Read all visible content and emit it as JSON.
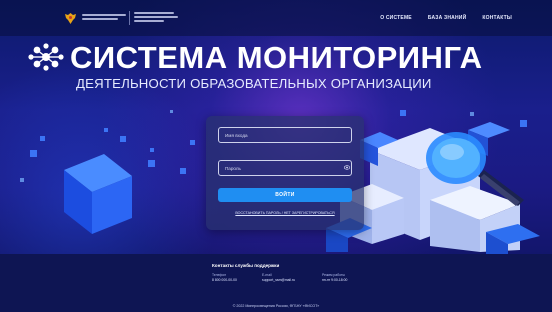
{
  "header": {
    "nav": [
      "О СИСТЕМЕ",
      "БАЗА ЗНАНИЙ",
      "КОНТАКТЫ"
    ]
  },
  "hero": {
    "title": "СИСТЕМА МОНИТОРИНГА",
    "subtitle": "ДЕЯТЕЛЬНОСТИ ОБРАЗОВАТЕЛЬНЫХ ОРГАНИЗАЦИИ"
  },
  "login": {
    "login_placeholder": "Имя входа",
    "password_placeholder": "Пароль",
    "submit_label": "ВОЙТИ",
    "restore_link": "ВОССТАНОВИТЬ ПАРОЛЬ / НЕТ ЗАРЕГИСТРИРОВАТЬСЯ"
  },
  "footer": {
    "title": "Контакты службы поддержки",
    "columns": [
      {
        "label": "Телефон",
        "value": "8 800 000-00-00"
      },
      {
        "label": "E-mail",
        "value": "support_ssm@mail.ru"
      },
      {
        "label": "Режим работы",
        "value": "пн-пт 9:00-18:00"
      }
    ],
    "copyright": "© 2022 Минпросвещения России, ФГБНУ «ФИСОТ»"
  },
  "colors": {
    "accent": "#1f8ef2",
    "background": "#1a1f8c",
    "footer": "#0e1553"
  },
  "icons": {
    "brand_emblem": "eagle-emblem-icon",
    "title_mark": "network-flower-icon",
    "password_toggle": "eye-icon"
  }
}
